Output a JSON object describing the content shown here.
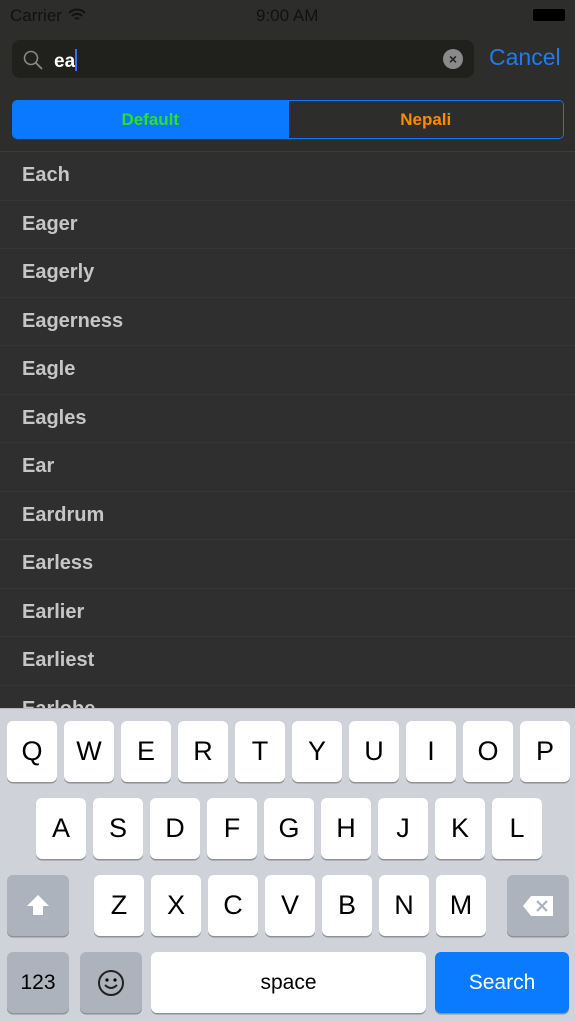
{
  "status": {
    "carrier": "Carrier",
    "time": "9:00 AM"
  },
  "search": {
    "value": "ea",
    "cancel": "Cancel"
  },
  "segments": [
    "Default",
    "Nepali"
  ],
  "results": [
    "Each",
    "Eager",
    "Eagerly",
    "Eagerness",
    "Eagle",
    "Eagles",
    "Ear",
    "Eardrum",
    "Earless",
    "Earlier",
    "Earliest",
    "Earlobe"
  ],
  "keyboard": {
    "row1": [
      "Q",
      "W",
      "E",
      "R",
      "T",
      "Y",
      "U",
      "I",
      "O",
      "P"
    ],
    "row2": [
      "A",
      "S",
      "D",
      "F",
      "G",
      "H",
      "J",
      "K",
      "L"
    ],
    "row3": [
      "Z",
      "X",
      "C",
      "V",
      "B",
      "N",
      "M"
    ],
    "numbers": "123",
    "space": "space",
    "search": "Search"
  },
  "colors": {
    "accent": "#0a78ff",
    "default_segment_text": "#2de02d",
    "nepali_segment_text": "#ff8a00"
  }
}
